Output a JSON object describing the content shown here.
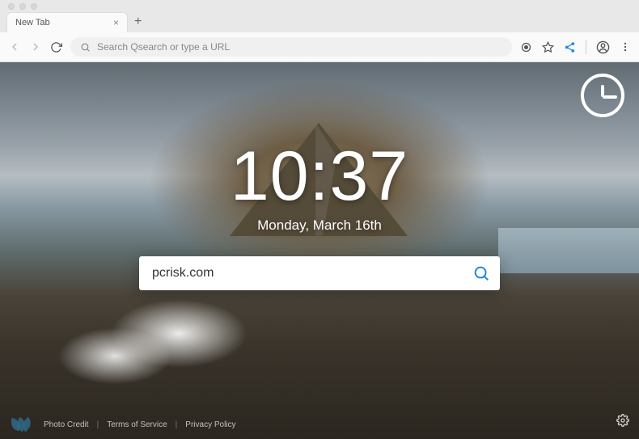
{
  "browser": {
    "tab_title": "New Tab",
    "url_placeholder": "Search Qsearch or type a URL"
  },
  "page": {
    "time": "10:37",
    "date": "Monday, March 16th",
    "search_value": "pcrisk.com"
  },
  "footer": {
    "photo_credit": "Photo Credit",
    "terms": "Terms of Service",
    "privacy": "Privacy Policy"
  }
}
